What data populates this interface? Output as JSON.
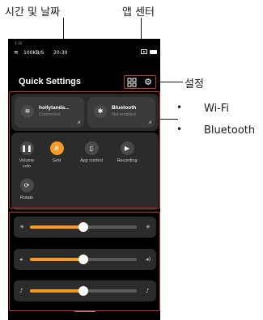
{
  "annotations": {
    "time_date": "시간 및 날짜",
    "app_center": "앱 센터",
    "settings": "설정",
    "features": [
      "Wi-Fi",
      "Bluetooth"
    ]
  },
  "status_bar": {
    "tiny_text": "3:16",
    "network": "100KB/S",
    "time": "20:30"
  },
  "quick_settings": {
    "title": "Quick Settings",
    "tiles": [
      {
        "name": "hollylanda...",
        "status": "Connected",
        "icon": "wifi-icon"
      },
      {
        "name": "Bluetooth",
        "status": "Not enabled",
        "icon": "bluetooth-icon"
      }
    ],
    "controls": [
      {
        "label": "Volume",
        "sublabel": "colo",
        "icon": "volume-icon",
        "active": false
      },
      {
        "label": "Grid",
        "sublabel": "",
        "icon": "grid-icon",
        "active": true
      },
      {
        "label": "App control",
        "sublabel": "",
        "icon": "phone-icon",
        "active": false
      },
      {
        "label": "Recording",
        "sublabel": "",
        "icon": "record-icon",
        "active": false
      },
      {
        "label": "Rotate",
        "sublabel": "",
        "icon": "rotate-icon",
        "active": false
      }
    ],
    "sliders": [
      {
        "name": "brightness",
        "level": 0.5
      },
      {
        "name": "volume",
        "level": 0.5
      },
      {
        "name": "microphone",
        "level": 0.5
      }
    ]
  },
  "colors": {
    "accent": "#f29a24",
    "highlight": "#c0392b"
  }
}
